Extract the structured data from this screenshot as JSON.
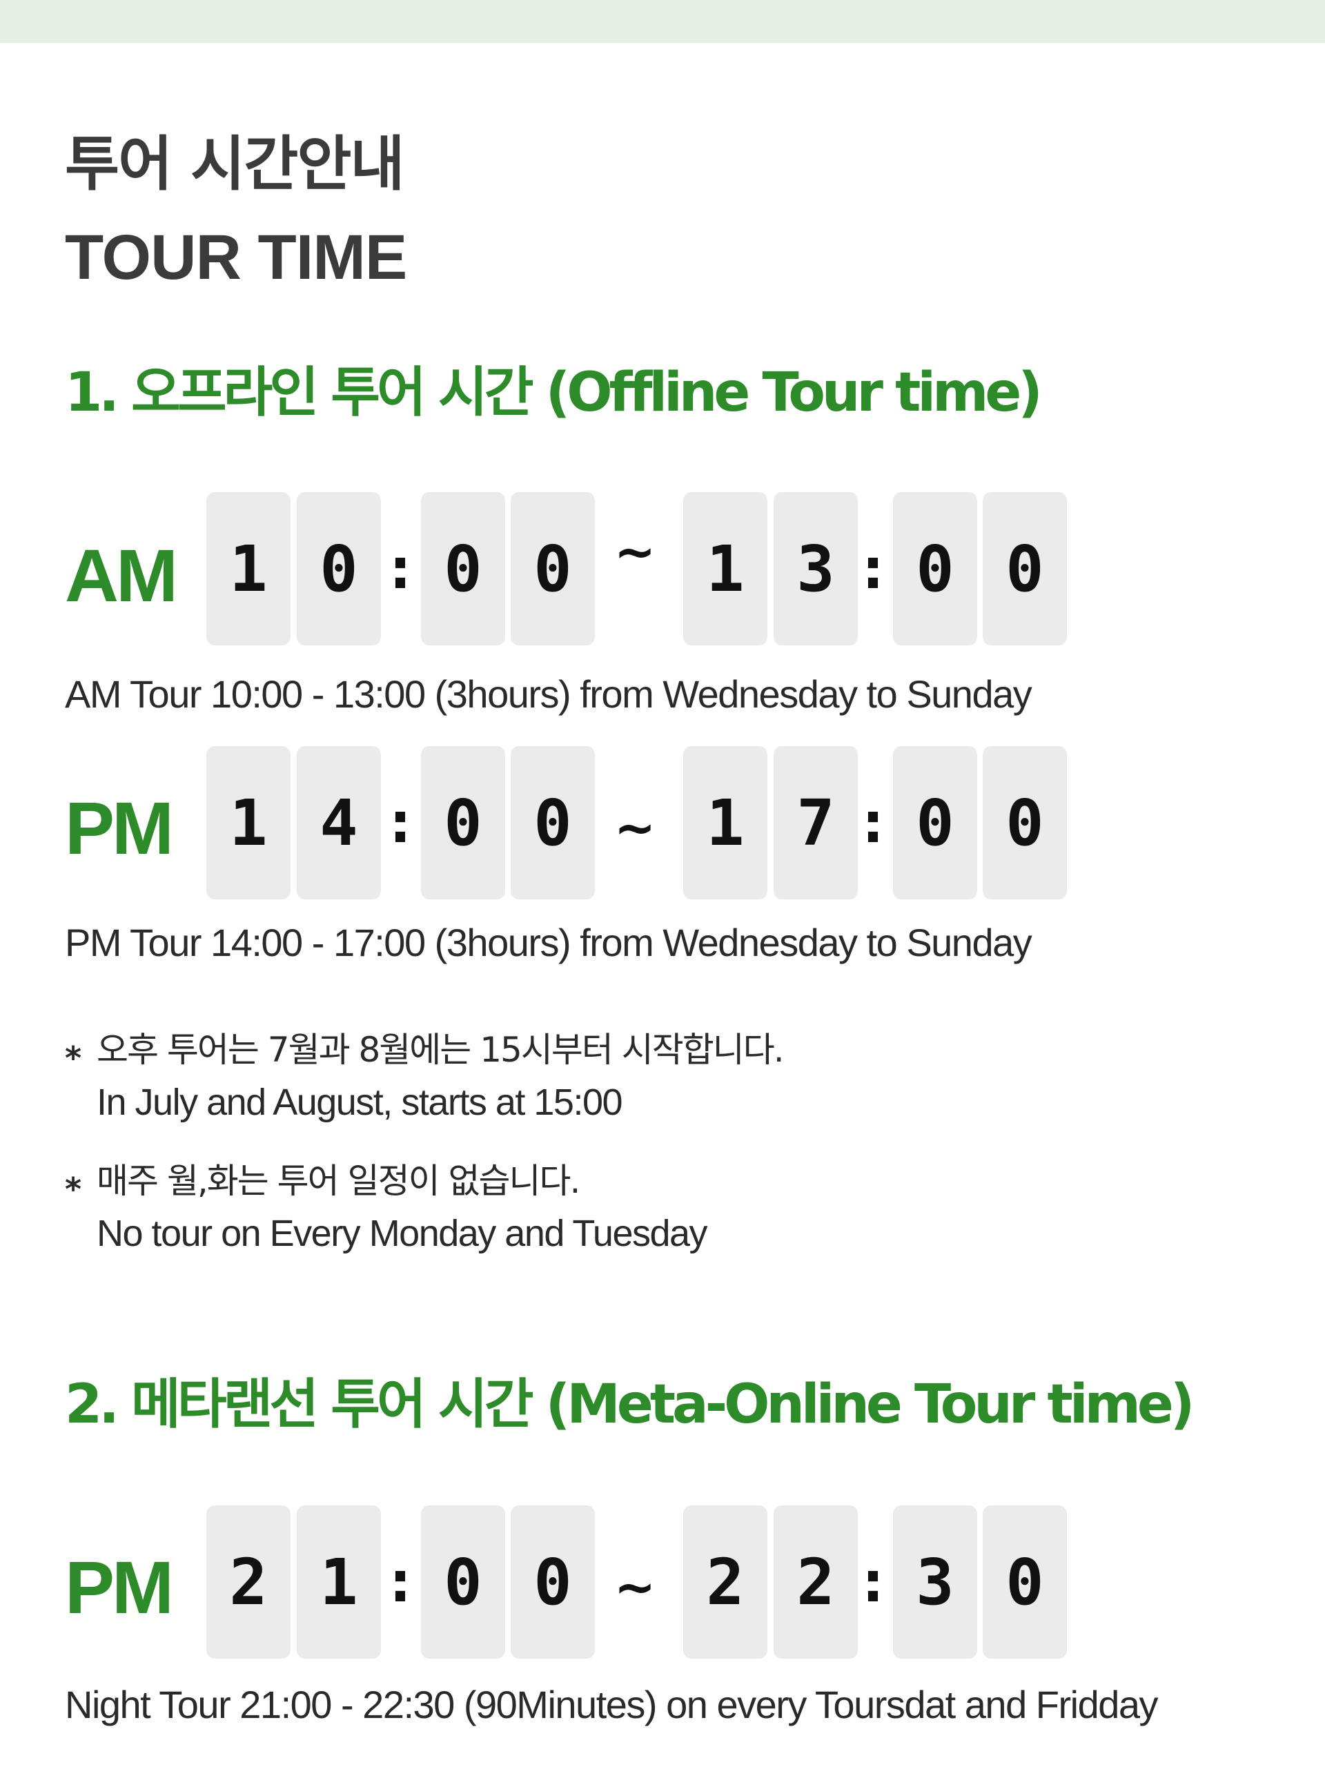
{
  "header": {
    "title_kr": "투어 시간안내",
    "title_en": "TOUR TIME"
  },
  "offline": {
    "title": "1. 오프라인 투어 시간 (Offline Tour time)",
    "am": {
      "label": "AM",
      "start_digits": [
        "1",
        "0",
        "0",
        "0"
      ],
      "end_digits": [
        "1",
        "3",
        "0",
        "0"
      ],
      "separator": ":",
      "range_symbol": "~",
      "description": "AM  Tour 10:00 - 13:00 (3hours) from Wednesday to Sunday"
    },
    "pm": {
      "label": "PM",
      "start_digits": [
        "1",
        "4",
        "0",
        "0"
      ],
      "end_digits": [
        "1",
        "7",
        "0",
        "0"
      ],
      "separator": ":",
      "range_symbol": "~",
      "description": "PM  Tour 14:00 - 17:00 (3hours) from Wednesday to Sunday"
    },
    "notes": [
      {
        "marker": "*",
        "kr": "오후 투어는 7월과 8월에는 15시부터 시작합니다.",
        "en": "In July and August, starts at 15:00"
      },
      {
        "marker": "*",
        "kr": "매주 월,화는 투어 일정이 없습니다.",
        "en": "No tour on Every Monday and Tuesday"
      }
    ]
  },
  "online": {
    "title": "2. 메타랜선 투어 시간 (Meta-Online Tour time)",
    "pm": {
      "label": "PM",
      "start_digits": [
        "2",
        "1",
        "0",
        "0"
      ],
      "end_digits": [
        "2",
        "2",
        "3",
        "0"
      ],
      "separator": ":",
      "range_symbol": "~",
      "description": "Night Tour 21:00 - 22:30 (90Minutes) on every Toursdat and Fridday"
    }
  },
  "colors": {
    "accent_green": "#2e8b2a",
    "heading_gray": "#3b3b3b",
    "digit_bg": "#ebebeb",
    "top_bar": "#e6efe3"
  }
}
